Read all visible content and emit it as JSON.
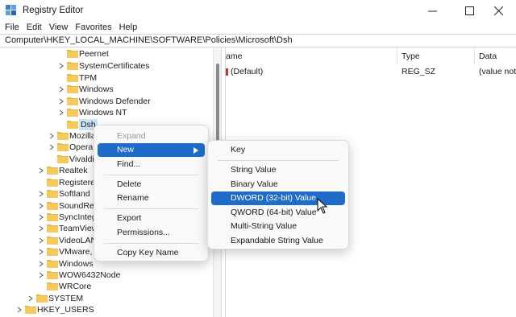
{
  "window": {
    "title": "Registry Editor"
  },
  "menubar": [
    "File",
    "Edit",
    "View",
    "Favorites",
    "Help"
  ],
  "address": "Computer\\HKEY_LOCAL_MACHINE\\SOFTWARE\\Policies\\Microsoft\\Dsh",
  "tree": [
    {
      "label": "Peernet",
      "expand": false
    },
    {
      "label": "SystemCertificates",
      "expand": true
    },
    {
      "label": "TPM",
      "expand": false
    },
    {
      "label": "Windows",
      "expand": true
    },
    {
      "label": "Windows Defender",
      "expand": true
    },
    {
      "label": "Windows NT",
      "expand": true
    },
    {
      "label": "Dsh",
      "expand": false,
      "selected": true
    },
    {
      "label": "Mozilla",
      "expand": true
    },
    {
      "label": "Opera",
      "expand": true
    },
    {
      "label": "Vivaldi",
      "expand": false
    },
    {
      "label": "Realtek",
      "expand": true
    },
    {
      "label": "Registered",
      "expand": false
    },
    {
      "label": "Softland",
      "expand": true
    },
    {
      "label": "SoundRes",
      "expand": true
    },
    {
      "label": "SyncInteg",
      "expand": true
    },
    {
      "label": "TeamView",
      "expand": true
    },
    {
      "label": "VideoLAN",
      "expand": true
    },
    {
      "label": "VMware,",
      "expand": true
    },
    {
      "label": "Windows",
      "expand": true
    },
    {
      "label": "WOW6432Node",
      "expand": true
    },
    {
      "label": "WRCore",
      "expand": false
    },
    {
      "label": "SYSTEM",
      "expand": true
    },
    {
      "label": "HKEY_USERS",
      "expand": true
    }
  ],
  "list": {
    "headers": [
      "ame",
      "Type",
      "Data"
    ],
    "rows": [
      {
        "name": "(Default)",
        "type": "REG_SZ",
        "data": "(value not"
      }
    ]
  },
  "context_menu": {
    "items": [
      "Expand",
      "New",
      "Find...",
      "Delete",
      "Rename",
      "Export",
      "Permissions...",
      "Copy Key Name"
    ]
  },
  "submenu": {
    "items": [
      "Key",
      "String Value",
      "Binary Value",
      "DWORD (32-bit) Value",
      "QWORD (64-bit) Value",
      "Multi-String Value",
      "Expandable String Value"
    ]
  },
  "colors": {
    "highlight": "#1f6bc9",
    "folder": "#e8b84a",
    "selection": "#cce4f7"
  }
}
